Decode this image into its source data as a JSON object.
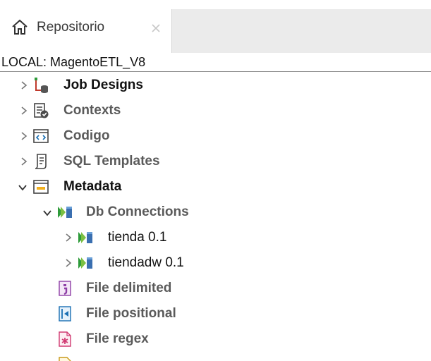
{
  "tab": {
    "label": "Repositorio",
    "icon": "home-icon",
    "close": "close-icon"
  },
  "path": "LOCAL: MagentoETL_V8",
  "tree": {
    "job_designs": "Job Designs",
    "contexts": "Contexts",
    "codigo": "Codigo",
    "sql_templates": "SQL Templates",
    "metadata": "Metadata",
    "db_connections": "Db Connections",
    "tienda": "tienda 0.1",
    "tiendadw": "tiendadw 0.1",
    "file_delimited": "File delimited",
    "file_positional": "File positional",
    "file_regex": "File regex"
  },
  "colors": {
    "accent_green": "#2e9b3a",
    "folder_yellow": "#f2b01e",
    "grey_text": "#5a5a5a"
  }
}
